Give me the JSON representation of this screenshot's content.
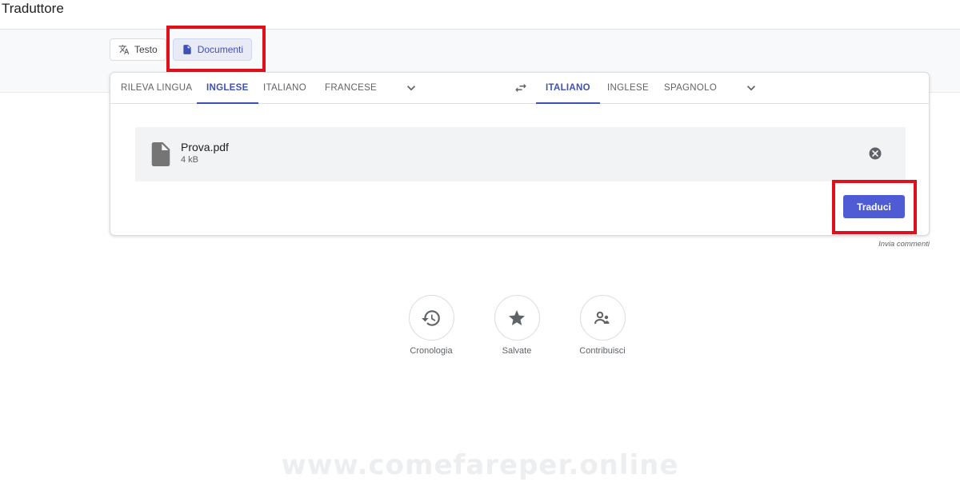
{
  "app": {
    "title": "Traduttore"
  },
  "mode_tabs": [
    {
      "label": "Testo",
      "icon": "translate-icon",
      "active": false
    },
    {
      "label": "Documenti",
      "icon": "document-icon",
      "active": true
    }
  ],
  "source_languages": [
    {
      "label": "RILEVA LINGUA",
      "active": false
    },
    {
      "label": "INGLESE",
      "active": true
    },
    {
      "label": "ITALIANO",
      "active": false
    },
    {
      "label": "FRANCESE",
      "active": false
    }
  ],
  "target_languages": [
    {
      "label": "ITALIANO",
      "active": true
    },
    {
      "label": "INGLESE",
      "active": false
    },
    {
      "label": "SPAGNOLO",
      "active": false
    }
  ],
  "file": {
    "name": "Prova.pdf",
    "size": "4 kB"
  },
  "translate_button": {
    "label": "Traduci"
  },
  "feedback": {
    "label": "Invia commenti"
  },
  "shortcuts": [
    {
      "label": "Cronologia",
      "icon": "history-icon"
    },
    {
      "label": "Salvate",
      "icon": "star-icon"
    },
    {
      "label": "Contribuisci",
      "icon": "community-icon"
    }
  ],
  "watermark": {
    "text": "www.comefareper.online"
  },
  "colors": {
    "accent": "#3f51b5",
    "button": "#4f5bd5",
    "highlight_box": "#e0101b"
  }
}
